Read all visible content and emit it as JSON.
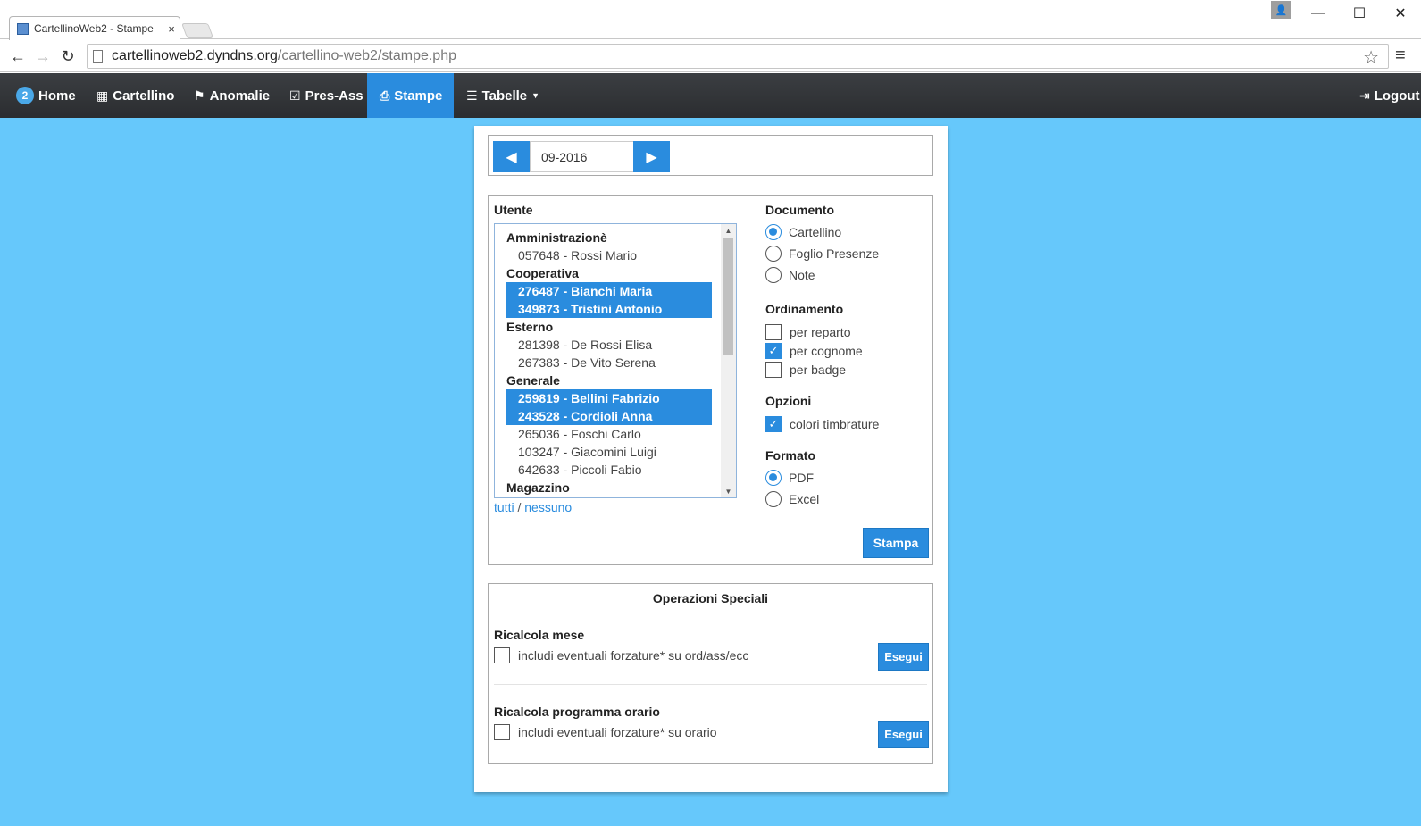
{
  "browser": {
    "tab_title": "CartellinoWeb2 - Stampe",
    "tab_close": "×",
    "url_host": "cartellinoweb2.dyndns.org",
    "url_path": "/cartellino-web2/stampe.php",
    "window_minimize": "—",
    "window_maximize": "☐",
    "window_close": "✕",
    "back": "←",
    "forward": "→",
    "reload": "↻",
    "star": "☆",
    "menu": "≡",
    "profile": "👤"
  },
  "navbar": {
    "badge": "2",
    "home": "Home",
    "cartellino": "Cartellino",
    "anomalie": "Anomalie",
    "pres_ass": "Pres-Ass",
    "stampe": "Stampe",
    "tabelle": "Tabelle",
    "logout": "Logout",
    "active_color": "#2a8cde"
  },
  "month": {
    "value": "09-2016",
    "prev": "◀",
    "next": "▶"
  },
  "utente": {
    "label": "Utente",
    "list": [
      {
        "text": "Amministrazionè",
        "type": "group"
      },
      {
        "text": "057648 - Rossi Mario",
        "type": "opt"
      },
      {
        "text": "Cooperativa",
        "type": "group"
      },
      {
        "text": "276487 - Bianchi Maria",
        "type": "sel"
      },
      {
        "text": "349873 - Tristini Antonio",
        "type": "sel"
      },
      {
        "text": "Esterno",
        "type": "group"
      },
      {
        "text": "281398 - De Rossi Elisa",
        "type": "opt"
      },
      {
        "text": "267383 - De Vito Serena",
        "type": "opt"
      },
      {
        "text": "Generale",
        "type": "group"
      },
      {
        "text": "259819 - Bellini Fabrizio",
        "type": "sel"
      },
      {
        "text": "243528 - Cordioli Anna",
        "type": "sel"
      },
      {
        "text": "265036 - Foschi Carlo",
        "type": "opt"
      },
      {
        "text": "103247 - Giacomini Luigi",
        "type": "opt"
      },
      {
        "text": "642633 - Piccoli Fabio",
        "type": "opt"
      },
      {
        "text": "Magazzino",
        "type": "group"
      }
    ],
    "tutti": "tutti",
    "separator": "/",
    "nessuno": "nessuno"
  },
  "documento": {
    "label": "Documento",
    "options": [
      "Cartellino",
      "Foglio Presenze",
      "Note"
    ],
    "selected": "Cartellino"
  },
  "ordinamento": {
    "label": "Ordinamento",
    "options": [
      "per reparto",
      "per cognome",
      "per badge"
    ],
    "checked": [
      false,
      true,
      false
    ]
  },
  "opzioni": {
    "label": "Opzioni",
    "colori_timbrature": "colori timbrature",
    "checked": true
  },
  "formato": {
    "label": "Formato",
    "options": [
      "PDF",
      "Excel"
    ],
    "selected": "PDF"
  },
  "stampa_button": "Stampa",
  "operazioni": {
    "title": "Operazioni Speciali",
    "ricalcola_mese": {
      "label": "Ricalcola mese",
      "checkbox": "includi eventuali forzature* su ord/ass/ecc",
      "button": "Esegui"
    },
    "ricalcola_programma": {
      "label": "Ricalcola programma orario",
      "checkbox": "includi eventuali forzature* su orario",
      "button": "Esegui"
    }
  }
}
